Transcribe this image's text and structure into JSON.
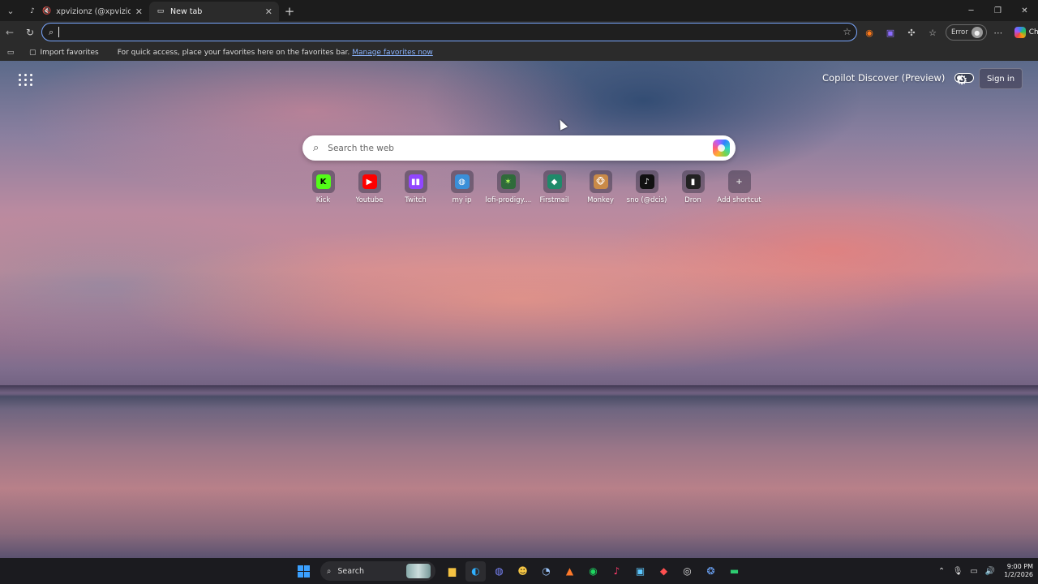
{
  "browser": {
    "tabs": [
      {
        "title": "xpvizionz (@xpvizionz) is LIVE",
        "active": false,
        "muted": true
      },
      {
        "title": "New tab",
        "active": true
      }
    ],
    "address": {
      "value": ""
    },
    "profile": {
      "status": "Error"
    },
    "chat_label": "Chat"
  },
  "favorites_bar": {
    "import_label": "Import favorites",
    "hint": "For quick access, place your favorites here on the favorites bar.",
    "manage_link": "Manage favorites now"
  },
  "new_tab": {
    "discover_label": "Copilot Discover (Preview)",
    "signin_label": "Sign in",
    "search_placeholder": "Search the web",
    "shortcuts": [
      {
        "label": "Kick",
        "icon": "K",
        "color": "#53fc18",
        "fg": "#000"
      },
      {
        "label": "Youtube",
        "icon": "▶",
        "color": "#ff0000",
        "fg": "#fff"
      },
      {
        "label": "Twitch",
        "icon": "▮▮",
        "color": "#9146ff",
        "fg": "#fff"
      },
      {
        "label": "my ip",
        "icon": "◍",
        "color": "#3a8fd8",
        "fg": "#fff"
      },
      {
        "label": "lofi-prodigy....",
        "icon": "✶",
        "color": "#2f6b3a",
        "fg": "#b8ff5a"
      },
      {
        "label": "Firstmail",
        "icon": "◆",
        "color": "#1f8a6a",
        "fg": "#fff"
      },
      {
        "label": "Monkey",
        "icon": "🐵",
        "color": "#c98a48",
        "fg": "#fff"
      },
      {
        "label": "sno (@dcis)",
        "icon": "♪",
        "color": "#111111",
        "fg": "#fff"
      },
      {
        "label": "Dron",
        "icon": "▮",
        "color": "#222222",
        "fg": "#fff"
      },
      {
        "label": "Add shortcut",
        "icon": "+",
        "color": "transparent",
        "fg": "#ddd"
      }
    ]
  },
  "taskbar": {
    "search_label": "Search",
    "time": "9:00 PM",
    "date": "1/2/2026"
  }
}
